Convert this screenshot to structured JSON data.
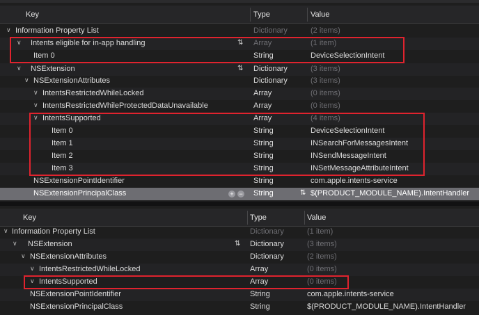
{
  "top": {
    "header": {
      "key": "Key",
      "type": "Type",
      "value": "Value"
    },
    "rows": [
      {
        "key": "Information Property List",
        "type": "Dictionary",
        "value": "(2 items)"
      },
      {
        "key": "Intents eligible for in-app handling",
        "type": "Array",
        "value": "(1 item)"
      },
      {
        "key": "Item 0",
        "type": "String",
        "value": "DeviceSelectionIntent"
      },
      {
        "key": "NSExtension",
        "type": "Dictionary",
        "value": "(3 items)"
      },
      {
        "key": "NSExtensionAttributes",
        "type": "Dictionary",
        "value": "(3 items)"
      },
      {
        "key": "IntentsRestrictedWhileLocked",
        "type": "Array",
        "value": "(0 items)"
      },
      {
        "key": "IntentsRestrictedWhileProtectedDataUnavailable",
        "type": "Array",
        "value": "(0 items)"
      },
      {
        "key": "IntentsSupported",
        "type": "Array",
        "value": "(4 items)"
      },
      {
        "key": "Item 0",
        "type": "String",
        "value": "DeviceSelectionIntent"
      },
      {
        "key": "Item 1",
        "type": "String",
        "value": "INSearchForMessagesIntent"
      },
      {
        "key": "Item 2",
        "type": "String",
        "value": "INSendMessageIntent"
      },
      {
        "key": "Item 3",
        "type": "String",
        "value": "INSetMessageAttributeIntent"
      },
      {
        "key": "NSExtensionPointIdentifier",
        "type": "String",
        "value": "com.apple.intents-service"
      },
      {
        "key": "NSExtensionPrincipalClass",
        "type": "String",
        "value": "$(PRODUCT_MODULE_NAME).IntentHandler"
      }
    ]
  },
  "bottom": {
    "header": {
      "key": "Key",
      "type": "Type",
      "value": "Value"
    },
    "rows": [
      {
        "key": "Information Property List",
        "type": "Dictionary",
        "value": "(1 item)"
      },
      {
        "key": "NSExtension",
        "type": "Dictionary",
        "value": "(3 items)"
      },
      {
        "key": "NSExtensionAttributes",
        "type": "Dictionary",
        "value": "(2 items)"
      },
      {
        "key": "IntentsRestrictedWhileLocked",
        "type": "Array",
        "value": "(0 items)"
      },
      {
        "key": "IntentsSupported",
        "type": "Array",
        "value": "(0 items)"
      },
      {
        "key": "NSExtensionPointIdentifier",
        "type": "String",
        "value": "com.apple.intents-service"
      },
      {
        "key": "NSExtensionPrincipalClass",
        "type": "String",
        "value": "$(PRODUCT_MODULE_NAME).IntentHandler"
      }
    ]
  },
  "glyphs": {
    "disclosure_open": "∨",
    "stepper": "⇅",
    "add": "+",
    "remove": "−"
  },
  "colors": {
    "highlight_box": "#e0232e",
    "selected_row": "#6d6d72"
  }
}
